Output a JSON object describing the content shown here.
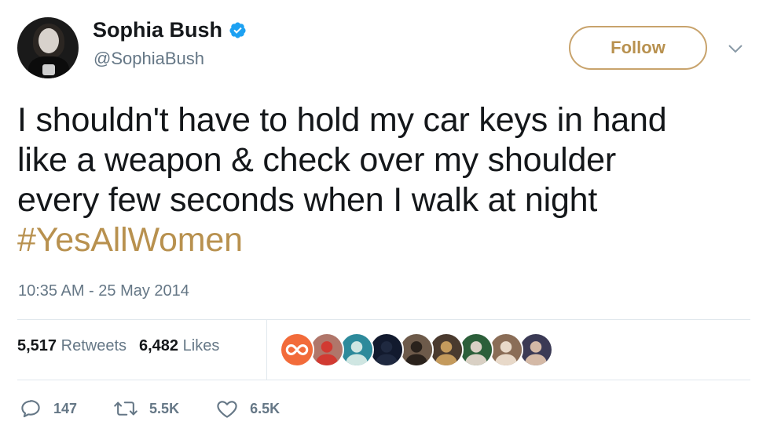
{
  "author": {
    "display_name": "Sophia Bush",
    "handle": "@SophiaBush",
    "verified": true
  },
  "follow_button_label": "Follow",
  "tweet": {
    "lines": [
      "I shouldn't have to hold my car keys in hand",
      "like a weapon & check over my shoulder",
      "every few seconds when I walk at night"
    ],
    "hashtag": "#YesAllWomen",
    "timestamp": "10:35 AM - 25 May 2014"
  },
  "stats": {
    "retweets_count": "5,517",
    "retweets_label": "Retweets",
    "likes_count": "6,482",
    "likes_label": "Likes"
  },
  "likers": [
    {
      "name": "liker-avatar-1",
      "bg": "#f26b3a",
      "fg": "#ffffff",
      "icon": "infinity-icon"
    },
    {
      "name": "liker-avatar-2",
      "bg": "#b0766a",
      "fg": "#d13a32",
      "icon": "person-icon"
    },
    {
      "name": "liker-avatar-3",
      "bg": "#2d8a9b",
      "fg": "#cfe6e2",
      "icon": "person-icon"
    },
    {
      "name": "liker-avatar-4",
      "bg": "#121a2e",
      "fg": "#1f2940",
      "icon": "person-icon"
    },
    {
      "name": "liker-avatar-5",
      "bg": "#6d5a4a",
      "fg": "#2a221c",
      "icon": "person-icon"
    },
    {
      "name": "liker-avatar-6",
      "bg": "#4a3a2e",
      "fg": "#c49a5c",
      "icon": "person-icon"
    },
    {
      "name": "liker-avatar-7",
      "bg": "#2c5f3a",
      "fg": "#d9d0c4",
      "icon": "person-icon"
    },
    {
      "name": "liker-avatar-8",
      "bg": "#8a6d57",
      "fg": "#e8d9c9",
      "icon": "person-icon"
    },
    {
      "name": "liker-avatar-9",
      "bg": "#3b3a55",
      "fg": "#d4b9a6",
      "icon": "person-icon"
    }
  ],
  "actions": {
    "replies": "147",
    "retweets": "5.5K",
    "likes": "6.5K"
  },
  "colors": {
    "accent": "#b8914f",
    "verified": "#1da1f2",
    "muted": "#657786",
    "text": "#14171a"
  }
}
